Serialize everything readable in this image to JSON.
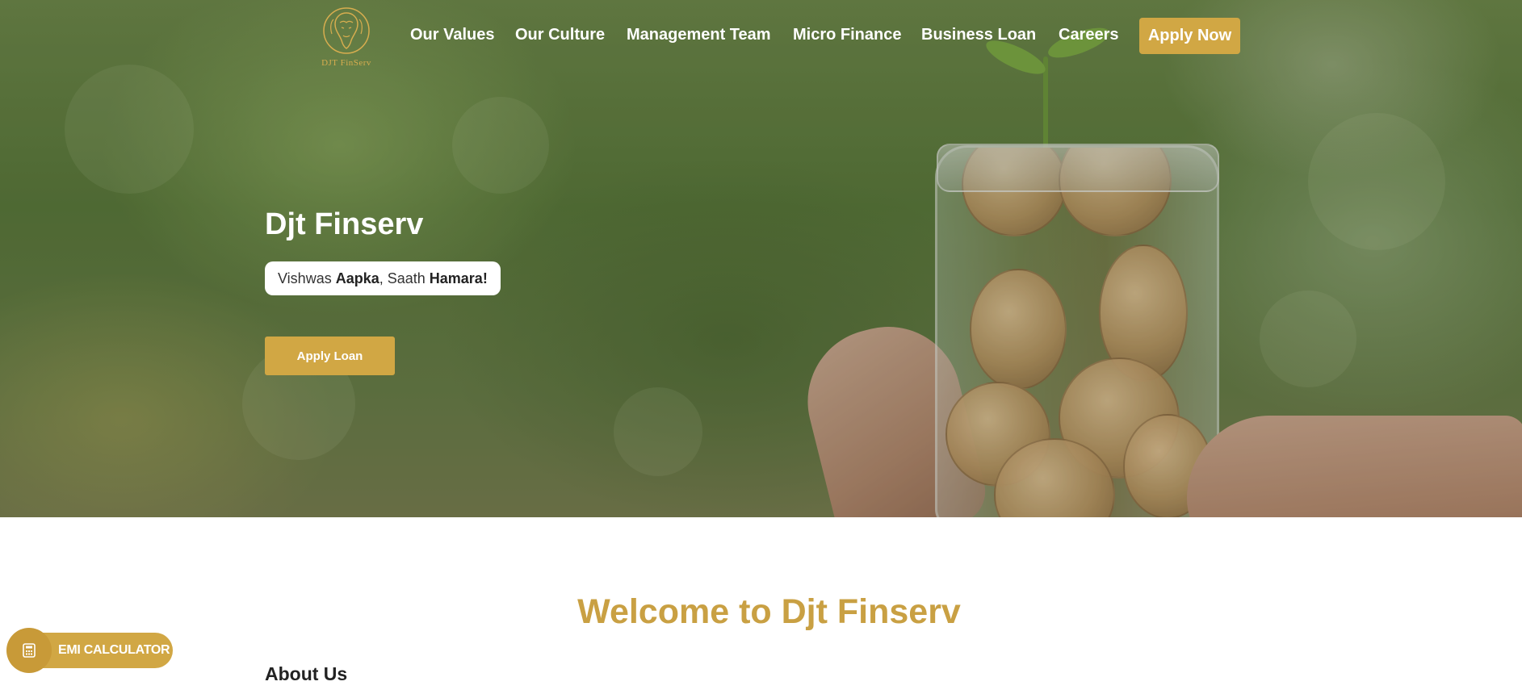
{
  "brand": {
    "logo_text": "DJT FinServ",
    "accent_color": "#d1a744"
  },
  "nav": {
    "items": [
      {
        "label": "Our Values"
      },
      {
        "label": "Our Culture"
      },
      {
        "label": "Management Team"
      },
      {
        "label": "Micro Finance"
      },
      {
        "label": "Business Loan"
      },
      {
        "label": "Careers"
      }
    ],
    "apply_now_label": "Apply Now"
  },
  "hero": {
    "title": "Djt Finserv",
    "tagline": {
      "part1": "Vishwas ",
      "bold1": "Aapka",
      "part2": ", Saath ",
      "bold2": "Hamara!"
    },
    "apply_loan_label": "Apply Loan"
  },
  "main": {
    "welcome_heading": "Welcome to Djt Finserv",
    "about_heading": "About Us"
  },
  "emi": {
    "label": "EMI CALCULATOR",
    "icon": "calculator-icon"
  }
}
